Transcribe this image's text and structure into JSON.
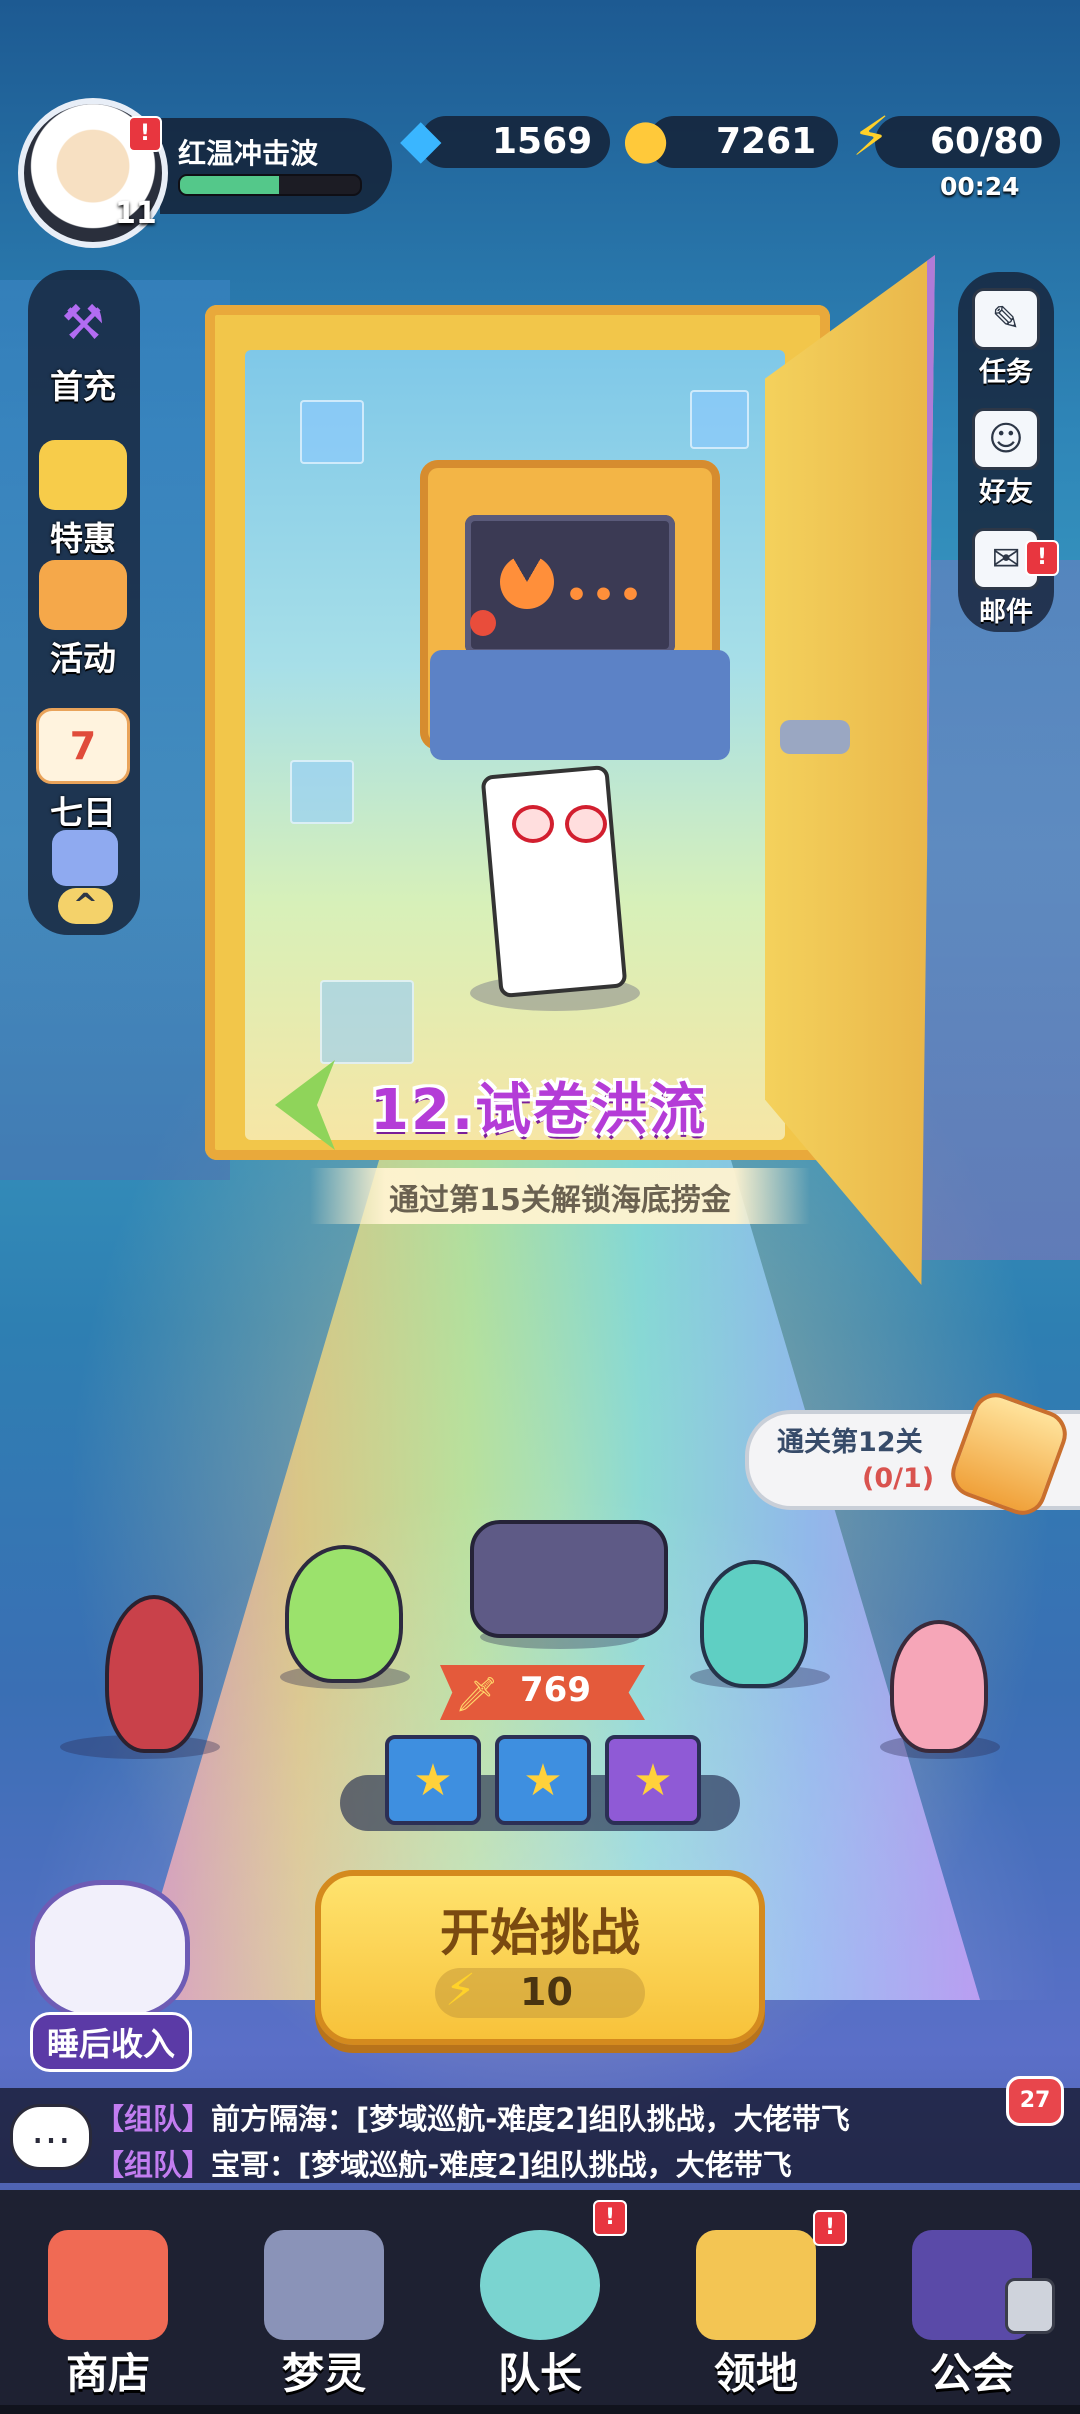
{
  "player": {
    "name": "红温冲击波",
    "level": "11",
    "exp_fraction": 0.55
  },
  "resources": {
    "gems": "1569",
    "gold": "7261",
    "energy": "60/80",
    "energy_timer": "00:24"
  },
  "left_menu": {
    "items": [
      {
        "label": "首充",
        "icon": "hammer-icon"
      },
      {
        "label": "特惠",
        "icon": "gift-card-icon"
      },
      {
        "label": "活动",
        "icon": "treasure-box-icon"
      },
      {
        "label": "七日",
        "icon": "calendar-icon",
        "day": "7"
      }
    ],
    "more_icon": "chevron-up-icon"
  },
  "right_menu": {
    "items": [
      {
        "label": "任务",
        "icon": "task-icon"
      },
      {
        "label": "好友",
        "icon": "friends-icon"
      },
      {
        "label": "邮件",
        "icon": "mail-icon"
      }
    ]
  },
  "stage": {
    "title": "12.试卷洪流",
    "subtitle": "通过第15关解锁海底捞金"
  },
  "quest": {
    "title": "通关第12关",
    "progress": "(0/1)"
  },
  "team": {
    "power": "769",
    "chests": 3
  },
  "start": {
    "label": "开始挑战",
    "cost": "10"
  },
  "idle": {
    "label": "睡后收入"
  },
  "chat": {
    "count": "27",
    "messages": [
      {
        "tag": "【组队】",
        "text": "前方隔海：[梦域巡航-难度2]组队挑战，大佬带飞"
      },
      {
        "tag": "【组队】",
        "text": "宝哥：[梦域巡航-难度2]组队挑战，大佬带飞"
      }
    ]
  },
  "nav": {
    "items": [
      {
        "label": "商店",
        "icon": "shop-icon"
      },
      {
        "label": "梦灵",
        "icon": "spirit-robot-icon"
      },
      {
        "label": "队长",
        "icon": "captain-icon"
      },
      {
        "label": "领地",
        "icon": "territory-door-icon"
      },
      {
        "label": "公会",
        "icon": "guild-icon"
      }
    ]
  },
  "colors": {
    "stage_title": "#b43cd7",
    "alert": "#e8363f",
    "start_button": "#f7c23a"
  }
}
